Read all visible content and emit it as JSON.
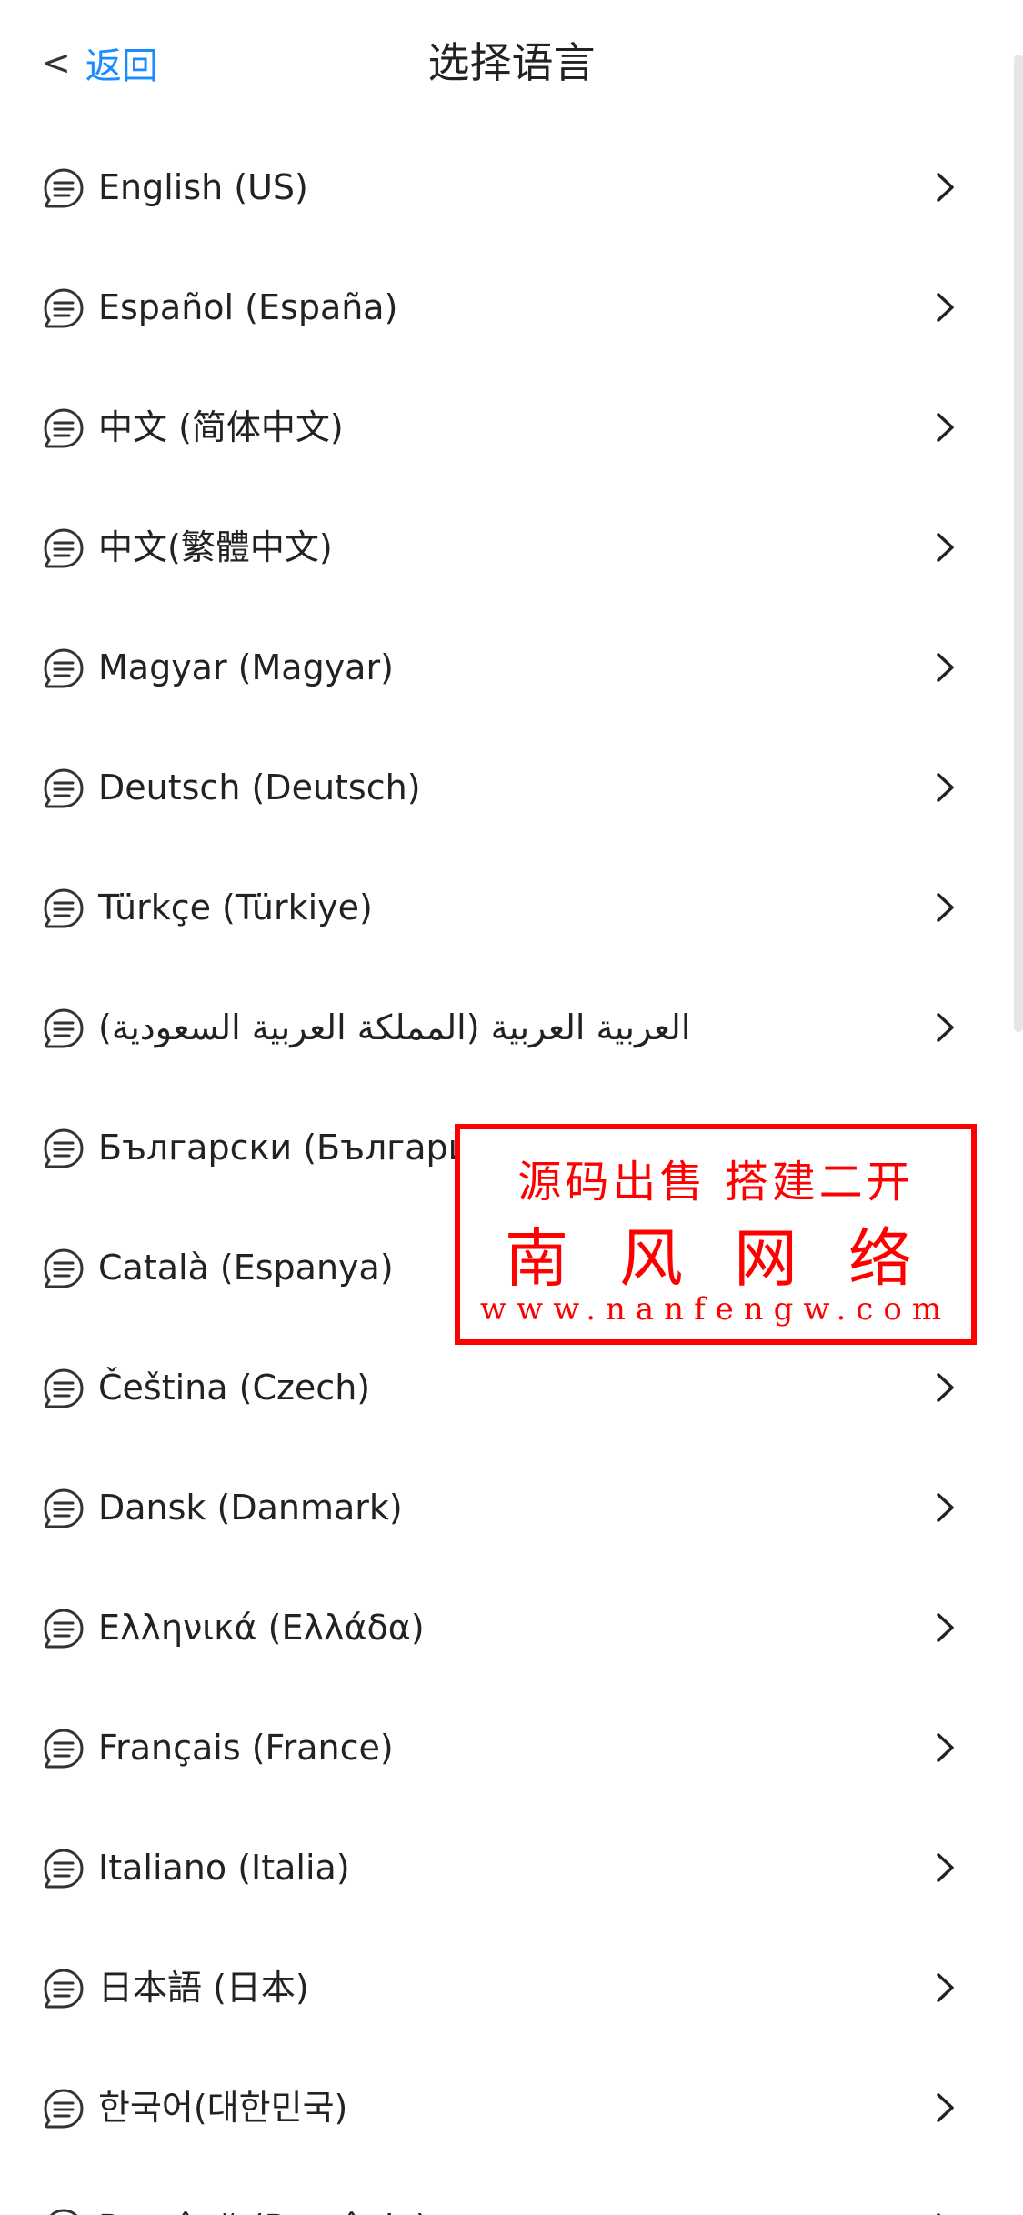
{
  "header": {
    "back_chevron": "<",
    "back_label": "返回",
    "title": "选择语言"
  },
  "languages": [
    {
      "label": "English (US)"
    },
    {
      "label": "Español (España)"
    },
    {
      "label": "中文 (简体中文)"
    },
    {
      "label": "中文(繁體中文)"
    },
    {
      "label": "Magyar (Magyar)"
    },
    {
      "label": "Deutsch (Deutsch)"
    },
    {
      "label": "Türkçe (Türkiye)"
    },
    {
      "label": "العربية العربية (المملكة العربية السعودية)"
    },
    {
      "label": "Български (България)"
    },
    {
      "label": "Català (Espanya)"
    },
    {
      "label": "Čeština (Czech)"
    },
    {
      "label": "Dansk (Danmark)"
    },
    {
      "label": "Ελληνικά (Ελλάδα)"
    },
    {
      "label": "Français (France)"
    },
    {
      "label": "Italiano (Italia)"
    },
    {
      "label": "日本語 (日本)"
    },
    {
      "label": "한국어(대한민국)"
    },
    {
      "label": "Română (România)"
    }
  ],
  "watermark": {
    "line1": "源码出售 搭建二开",
    "line2": "南风网络",
    "line3": "www.nanfengw.com"
  },
  "icons": {
    "language_item": "message-lines-icon",
    "row_arrow": "chevron-right-icon"
  },
  "colors": {
    "accent": "#1a8cff",
    "text": "#222222",
    "watermark": "#ff0000"
  }
}
